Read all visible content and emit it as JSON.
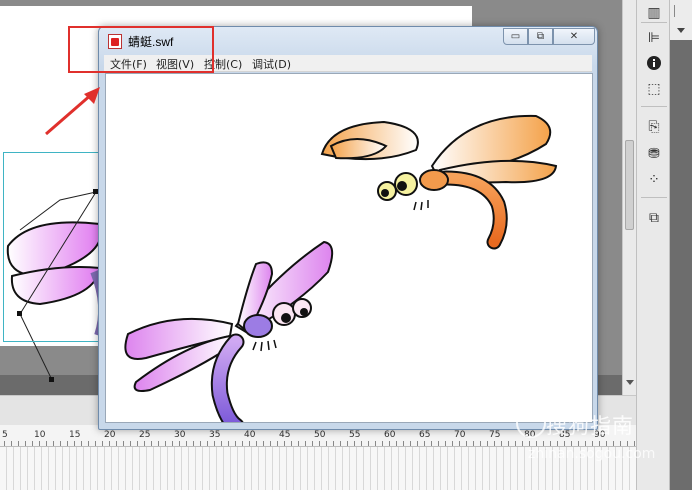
{
  "swf_window": {
    "title": "蜻蜓.swf",
    "controls": {
      "minimize": "▭",
      "maximize": "⧉",
      "close": "✕"
    },
    "menu": [
      {
        "label": "文件(F)"
      },
      {
        "label": "视图(V)"
      },
      {
        "label": "控制(C)"
      },
      {
        "label": "调试(D)"
      }
    ]
  },
  "timeline": {
    "ruler_labels": [
      "5",
      "10",
      "15",
      "20",
      "25",
      "30",
      "35",
      "40",
      "45",
      "50",
      "55",
      "60",
      "65",
      "70",
      "75",
      "80",
      "85",
      "90"
    ]
  },
  "watermark": {
    "brand": "搜狗指南",
    "url": "zhinan.sogou.com"
  },
  "colors": {
    "highlight": "#e0302c",
    "selection": "#3fb4c4",
    "orange_dragonfly": "#f0903a",
    "purple_dragonfly": "#b67be0"
  },
  "icons": [
    "bar-chart-icon",
    "align-icon",
    "info-icon",
    "transform-icon",
    "components-icon",
    "library-icon",
    "color-swatches-icon",
    "movie-explorer-icon",
    "swf-file-icon"
  ]
}
